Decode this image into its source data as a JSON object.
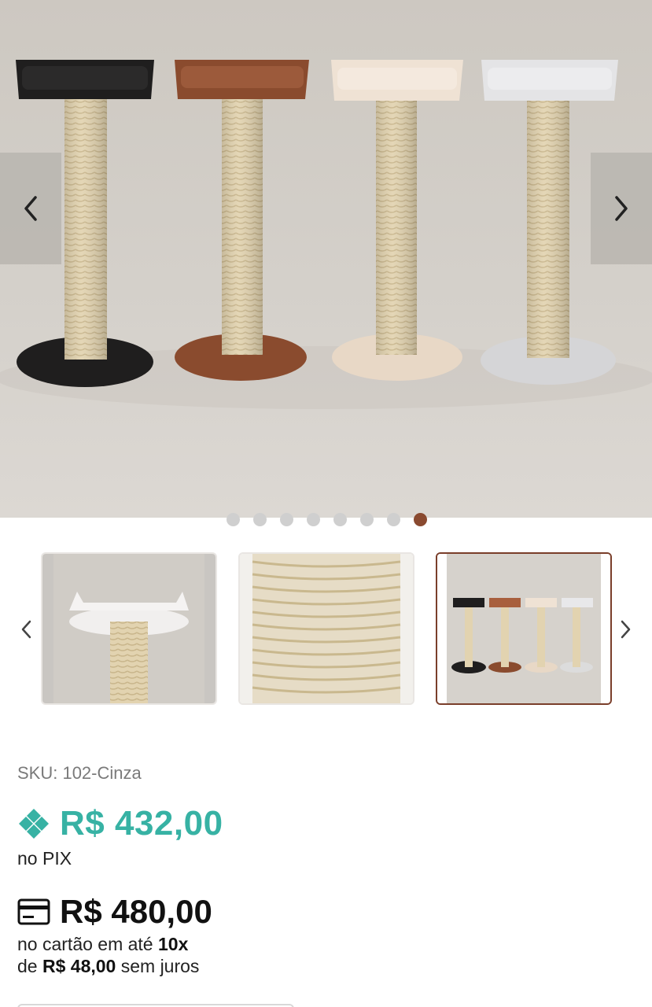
{
  "gallery": {
    "prev_icon": "chevron-left-icon",
    "next_icon": "chevron-right-icon",
    "image_count": 8,
    "active_index": 7,
    "product_colors": [
      "#1f1e1e",
      "#8a4b2e",
      "#e8d8c6",
      "#d5d5d7"
    ]
  },
  "thumbnails": {
    "prev_icon": "chevron-left-icon",
    "next_icon": "chevron-right-icon",
    "selected_index": 2,
    "selected_border_color": "#7a3e2a"
  },
  "product": {
    "sku": "SKU: 102-Cinza",
    "pix_icon": "pix-icon",
    "pix_price": "R$ 432,00",
    "pix_label": "no PIX",
    "card_icon": "credit-card-icon",
    "card_price": "R$ 480,00",
    "installments_prefix": "no cartão em até ",
    "installments_count": "10x",
    "installments_de": "de ",
    "installment_value": "R$ 48,00",
    "installments_suffix": " sem juros",
    "pix_color": "#37b2a4"
  }
}
